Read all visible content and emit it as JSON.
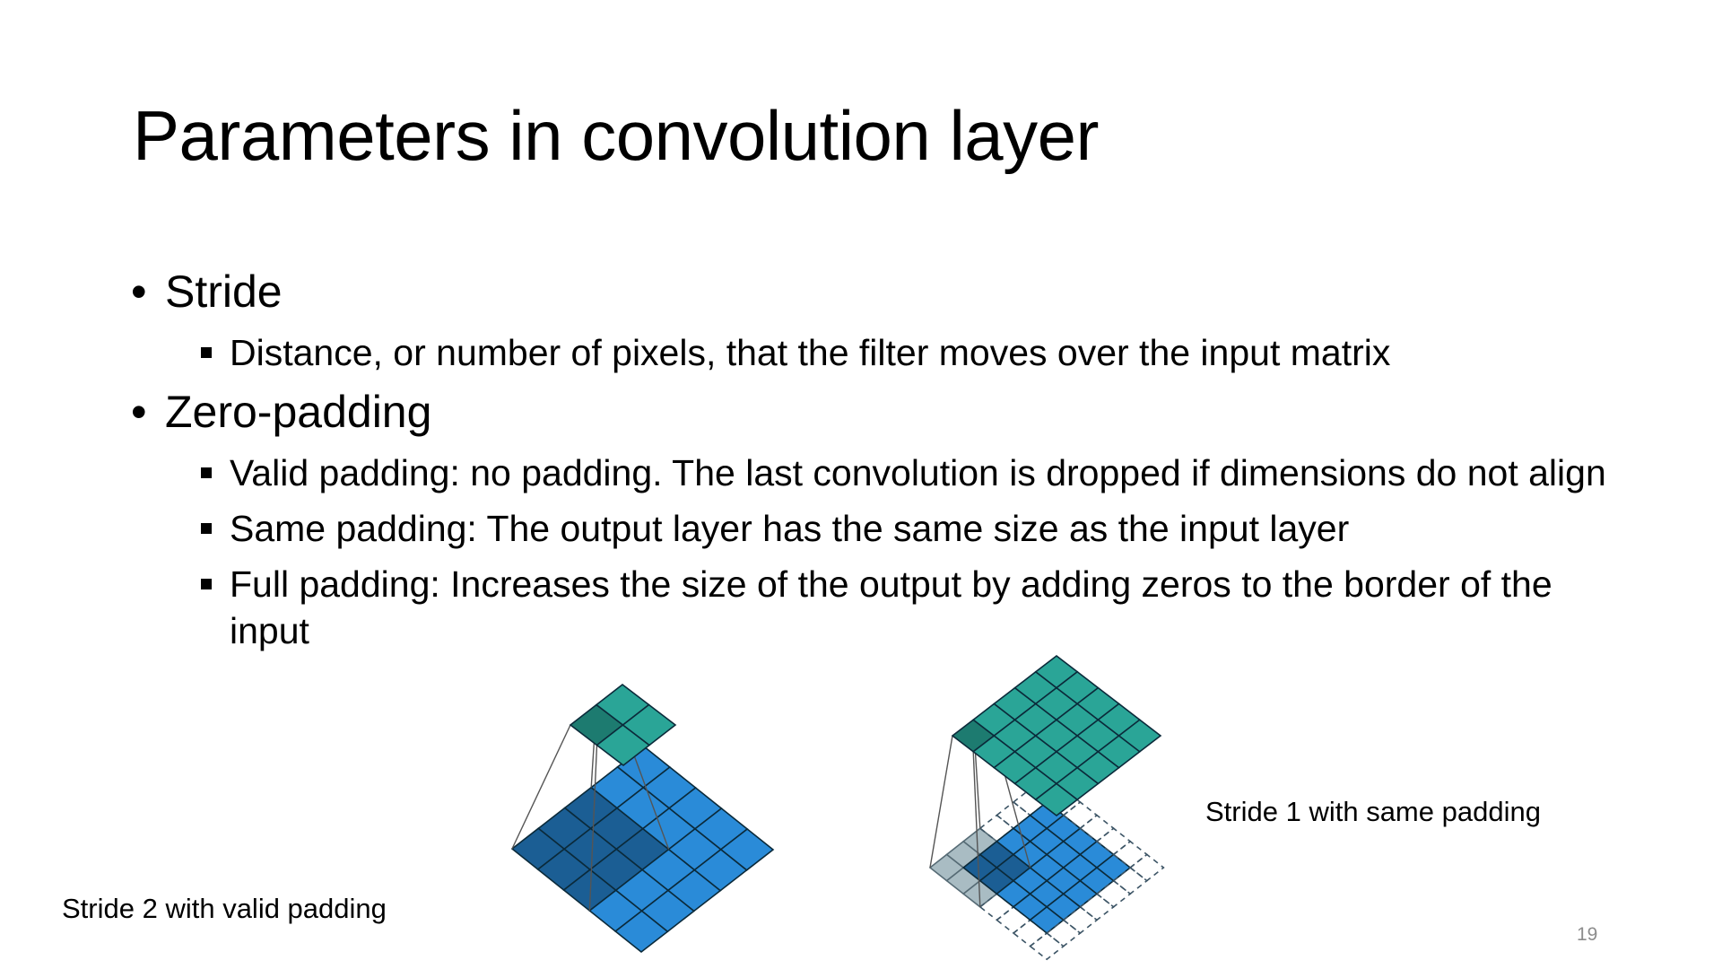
{
  "slide": {
    "title": "Parameters in convolution layer",
    "bullets": [
      {
        "text": "Stride",
        "sub": [
          "Distance, or number of pixels, that the filter moves over the input matrix"
        ]
      },
      {
        "text": "Zero-padding",
        "sub": [
          "Valid padding: no padding. The last convolution is dropped if dimensions do not align",
          "Same padding: The output layer has the same size as the input layer",
          "Full padding: Increases the size of the output by adding zeros to the border of the input"
        ]
      }
    ],
    "figures": {
      "left_caption": "Stride 2 with valid padding",
      "right_caption": "Stride 1 with same padding"
    },
    "page_number": "19",
    "colors": {
      "input_blue": "#2a8bd8",
      "input_dark": "#1b5e94",
      "output_teal": "#2aa597",
      "output_dark": "#1d7b70",
      "padding_gray": "#a9bcc3",
      "grid_line": "#0b2a3a"
    }
  }
}
